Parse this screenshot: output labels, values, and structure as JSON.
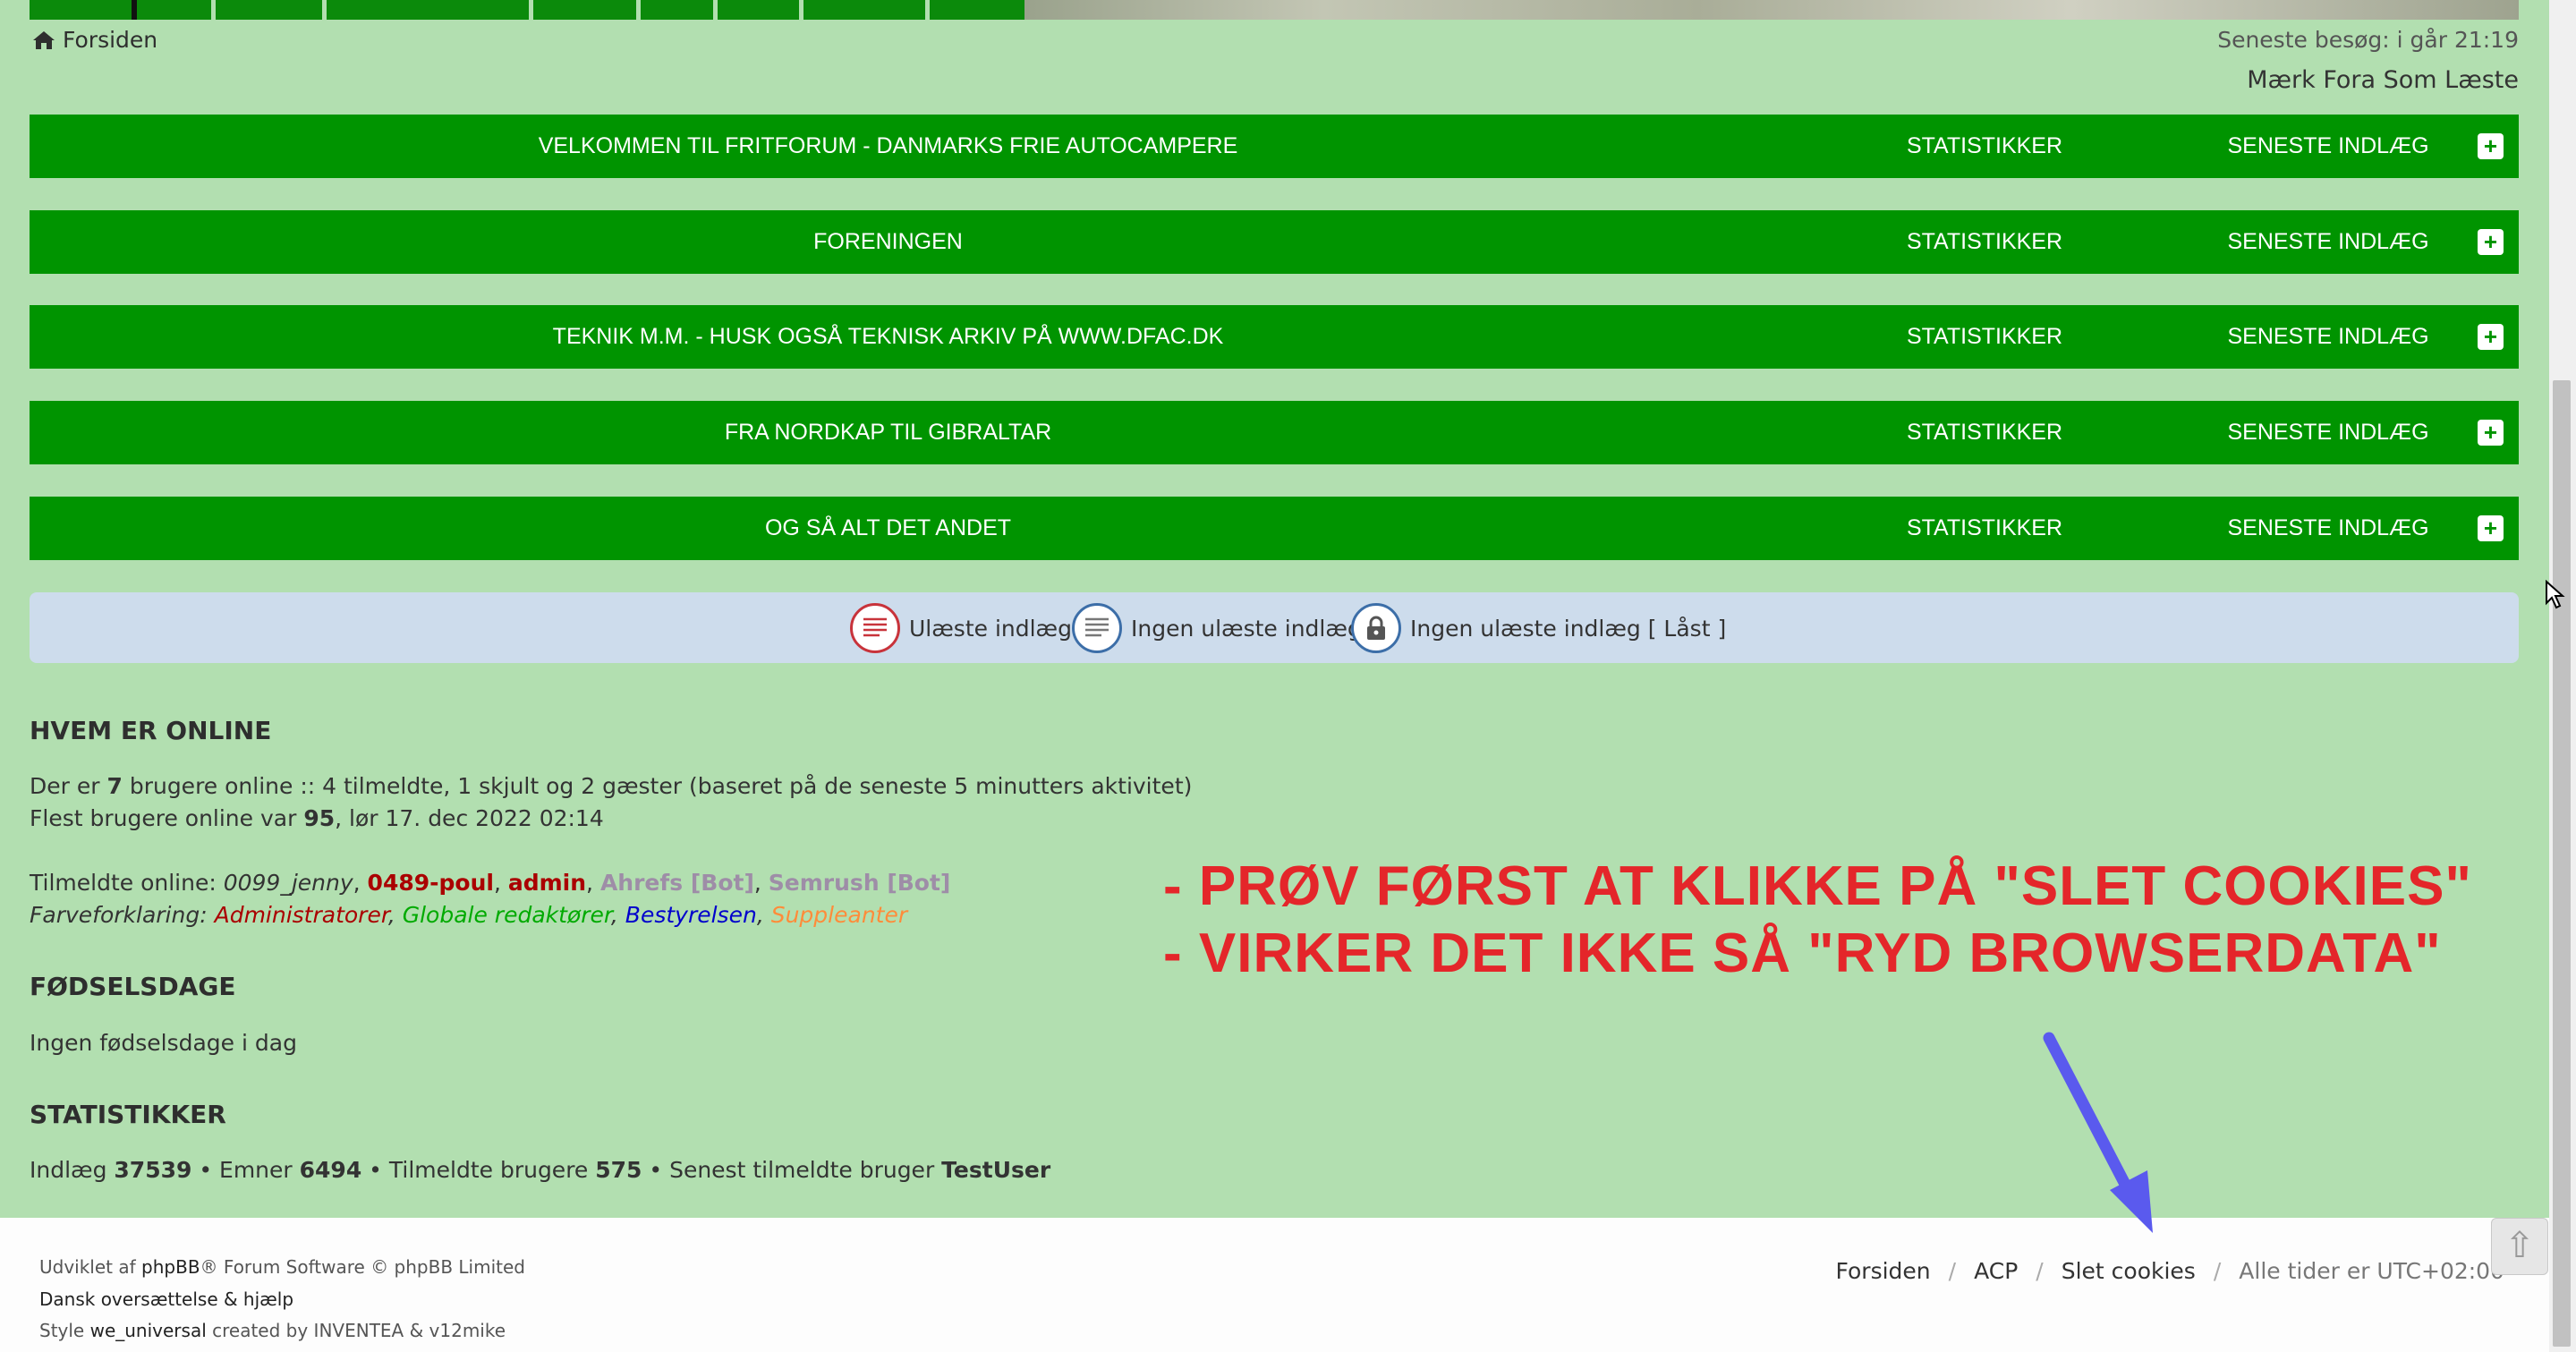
{
  "header": {
    "breadcrumb_home": "Forsiden",
    "last_visit": "Seneste besøg: i går 21:19",
    "mark_read": "Mærk Fora Som Læste"
  },
  "categories": [
    {
      "title": "VELKOMMEN TIL FRITFORUM - DANMARKS FRIE AUTOCAMPERE",
      "stats": "STATISTIKKER",
      "latest": "SENESTE INDLÆG",
      "toggle": "+"
    },
    {
      "title": "FORENINGEN",
      "stats": "STATISTIKKER",
      "latest": "SENESTE INDLÆG",
      "toggle": "+"
    },
    {
      "title": "TEKNIK M.M. - HUSK OGSÅ TEKNISK ARKIV PÅ WWW.DFAC.DK",
      "stats": "STATISTIKKER",
      "latest": "SENESTE INDLÆG",
      "toggle": "+"
    },
    {
      "title": "FRA NORDKAP TIL GIBRALTAR",
      "stats": "STATISTIKKER",
      "latest": "SENESTE INDLÆG",
      "toggle": "+"
    },
    {
      "title": "OG SÅ ALT DET ANDET",
      "stats": "STATISTIKKER",
      "latest": "SENESTE INDLÆG",
      "toggle": "+"
    }
  ],
  "legend": {
    "unread": "Ulæste indlæg",
    "no_unread": "Ingen ulæste indlæg",
    "no_unread_locked": "Ingen ulæste indlæg [ Låst ]"
  },
  "online": {
    "heading": "HVEM ER ONLINE",
    "line1_pre": "Der er ",
    "line1_count": "7",
    "line1_post": " brugere online :: 4 tilmeldte, 1 skjult og 2 gæster (baseret på de seneste 5 minutters aktivitet)",
    "line2_pre": "Flest brugere online var ",
    "line2_count": "95",
    "line2_post": ", lør 17. dec 2022 02:14",
    "registered_label": "Tilmeldte online: ",
    "users": [
      "0099_jenny",
      "0489-poul",
      "admin",
      "Ahrefs [Bot]",
      "Semrush [Bot]"
    ],
    "color_legend_label": "Farveforklaring: ",
    "groups": [
      "Administratorer",
      "Globale redaktører",
      "Bestyrelsen",
      "Suppleanter"
    ]
  },
  "birthdays": {
    "heading": "FØDSELSDAGE",
    "text": "Ingen fødselsdage i dag"
  },
  "stats": {
    "heading": "STATISTIKKER",
    "posts_label": "Indlæg ",
    "posts": "37539",
    "topics_label": " • Emner ",
    "topics": "6494",
    "members_label": " • Tilmeldte brugere ",
    "members": "575",
    "newest_label": " • Senest tilmeldte bruger ",
    "newest": "TestUser"
  },
  "annotation": {
    "line1": "- PRØV FØRST AT KLIKKE PÅ \"SLET COOKIES\"",
    "line2": "- VIRKER DET IKKE SÅ \"RYD BROWSERDATA\""
  },
  "footer": {
    "credit_pre": "Udviklet af ",
    "credit_link": "phpBB",
    "credit_post": "® Forum Software © phpBB Limited",
    "translation": "Dansk oversættelse & hjælp",
    "style_pre": "Style ",
    "style_link": "we_universal",
    "style_post": " created by INVENTEA & v12mike",
    "links": [
      "Forsiden",
      "ACP",
      "Slet cookies"
    ],
    "separator": "/",
    "timezone": "Alle tider er UTC+02:00"
  },
  "colors": {
    "page_bg": "#b2dfb0",
    "category_bar": "#009400",
    "legend_bg": "#cddcec",
    "annotation_red": "#e4262a",
    "arrow": "#5a5aee"
  }
}
